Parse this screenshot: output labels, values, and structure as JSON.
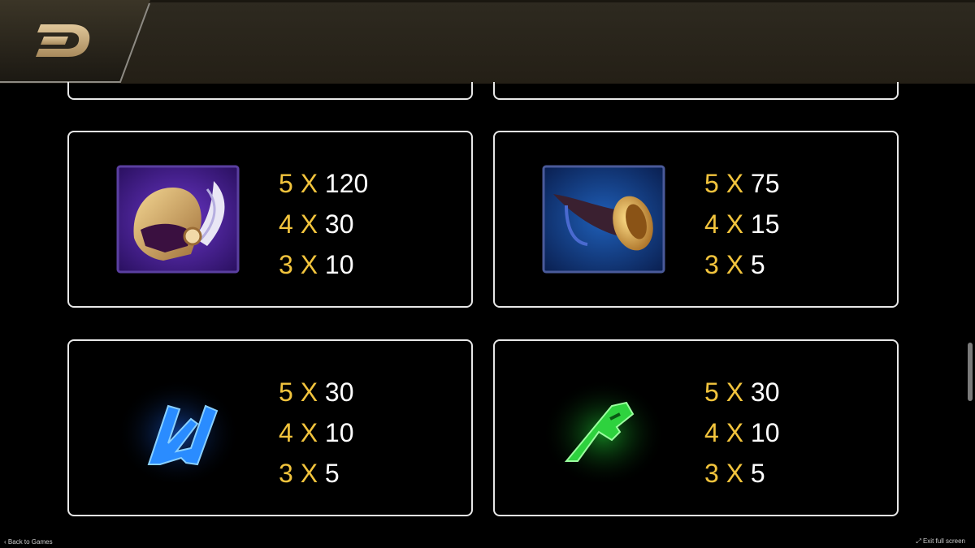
{
  "header": {
    "logo": "D-logo-icon"
  },
  "cards": [
    {
      "symbol": "winged-helmet-icon",
      "rows": [
        {
          "count": "5",
          "x": "X",
          "value": "120"
        },
        {
          "count": "4",
          "x": "X",
          "value": "30"
        },
        {
          "count": "3",
          "x": "X",
          "value": "10"
        }
      ]
    },
    {
      "symbol": "horn-icon",
      "rows": [
        {
          "count": "5",
          "x": "X",
          "value": "75"
        },
        {
          "count": "4",
          "x": "X",
          "value": "15"
        },
        {
          "count": "3",
          "x": "X",
          "value": "5"
        }
      ]
    },
    {
      "symbol": "blue-rune-icon",
      "rows": [
        {
          "count": "5",
          "x": "X",
          "value": "30"
        },
        {
          "count": "4",
          "x": "X",
          "value": "10"
        },
        {
          "count": "3",
          "x": "X",
          "value": "5"
        }
      ]
    },
    {
      "symbol": "green-rune-icon",
      "rows": [
        {
          "count": "5",
          "x": "X",
          "value": "30"
        },
        {
          "count": "4",
          "x": "X",
          "value": "10"
        },
        {
          "count": "3",
          "x": "X",
          "value": "5"
        }
      ]
    }
  ],
  "footer": {
    "back_label": "Back to Games",
    "exit_label": "Exit full screen"
  },
  "colors": {
    "multiplier": "#f2c43d",
    "card_border": "#e8e8e8",
    "header": "#2e2a20"
  }
}
